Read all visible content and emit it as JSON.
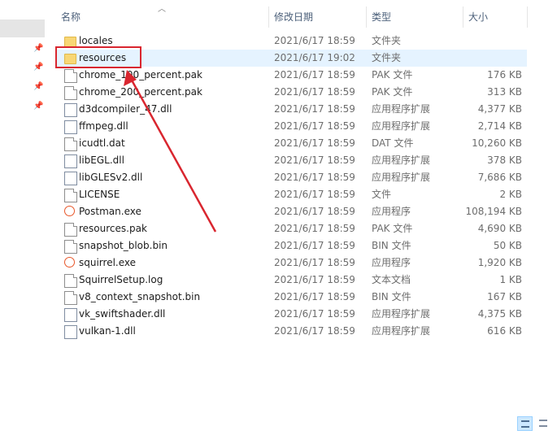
{
  "header": {
    "name": "名称",
    "modified": "修改日期",
    "type": "类型",
    "size": "大小"
  },
  "files": [
    {
      "name": "locales",
      "date": "2021/6/17 18:59",
      "type": "文件夹",
      "size": "",
      "icon": "folder-icon",
      "selected": false
    },
    {
      "name": "resources",
      "date": "2021/6/17 19:02",
      "type": "文件夹",
      "size": "",
      "icon": "folder-icon",
      "selected": true
    },
    {
      "name": "chrome_100_percent.pak",
      "date": "2021/6/17 18:59",
      "type": "PAK 文件",
      "size": "176 KB",
      "icon": "file-icon",
      "selected": false
    },
    {
      "name": "chrome_200_percent.pak",
      "date": "2021/6/17 18:59",
      "type": "PAK 文件",
      "size": "313 KB",
      "icon": "file-icon",
      "selected": false
    },
    {
      "name": "d3dcompiler_47.dll",
      "date": "2021/6/17 18:59",
      "type": "应用程序扩展",
      "size": "4,377 KB",
      "icon": "dll-icon",
      "selected": false
    },
    {
      "name": "ffmpeg.dll",
      "date": "2021/6/17 18:59",
      "type": "应用程序扩展",
      "size": "2,714 KB",
      "icon": "dll-icon",
      "selected": false
    },
    {
      "name": "icudtl.dat",
      "date": "2021/6/17 18:59",
      "type": "DAT 文件",
      "size": "10,260 KB",
      "icon": "file-icon",
      "selected": false
    },
    {
      "name": "libEGL.dll",
      "date": "2021/6/17 18:59",
      "type": "应用程序扩展",
      "size": "378 KB",
      "icon": "dll-icon",
      "selected": false
    },
    {
      "name": "libGLESv2.dll",
      "date": "2021/6/17 18:59",
      "type": "应用程序扩展",
      "size": "7,686 KB",
      "icon": "dll-icon",
      "selected": false
    },
    {
      "name": "LICENSE",
      "date": "2021/6/17 18:59",
      "type": "文件",
      "size": "2 KB",
      "icon": "file-icon",
      "selected": false
    },
    {
      "name": "Postman.exe",
      "date": "2021/6/17 18:59",
      "type": "应用程序",
      "size": "108,194 KB",
      "icon": "exe-icon",
      "selected": false
    },
    {
      "name": "resources.pak",
      "date": "2021/6/17 18:59",
      "type": "PAK 文件",
      "size": "4,690 KB",
      "icon": "file-icon",
      "selected": false
    },
    {
      "name": "snapshot_blob.bin",
      "date": "2021/6/17 18:59",
      "type": "BIN 文件",
      "size": "50 KB",
      "icon": "file-icon",
      "selected": false
    },
    {
      "name": "squirrel.exe",
      "date": "2021/6/17 18:59",
      "type": "应用程序",
      "size": "1,920 KB",
      "icon": "exe-icon",
      "selected": false
    },
    {
      "name": "SquirrelSetup.log",
      "date": "2021/6/17 18:59",
      "type": "文本文档",
      "size": "1 KB",
      "icon": "file-icon",
      "selected": false
    },
    {
      "name": "v8_context_snapshot.bin",
      "date": "2021/6/17 18:59",
      "type": "BIN 文件",
      "size": "167 KB",
      "icon": "file-icon",
      "selected": false
    },
    {
      "name": "vk_swiftshader.dll",
      "date": "2021/6/17 18:59",
      "type": "应用程序扩展",
      "size": "4,375 KB",
      "icon": "dll-icon",
      "selected": false
    },
    {
      "name": "vulkan-1.dll",
      "date": "2021/6/17 18:59",
      "type": "应用程序扩展",
      "size": "616 KB",
      "icon": "dll-icon",
      "selected": false
    }
  ],
  "annotation": {
    "color": "#d9262f"
  },
  "colors": {
    "selection": "#e5f3ff",
    "folder": "#f8d775",
    "exe": "#e8572a"
  }
}
